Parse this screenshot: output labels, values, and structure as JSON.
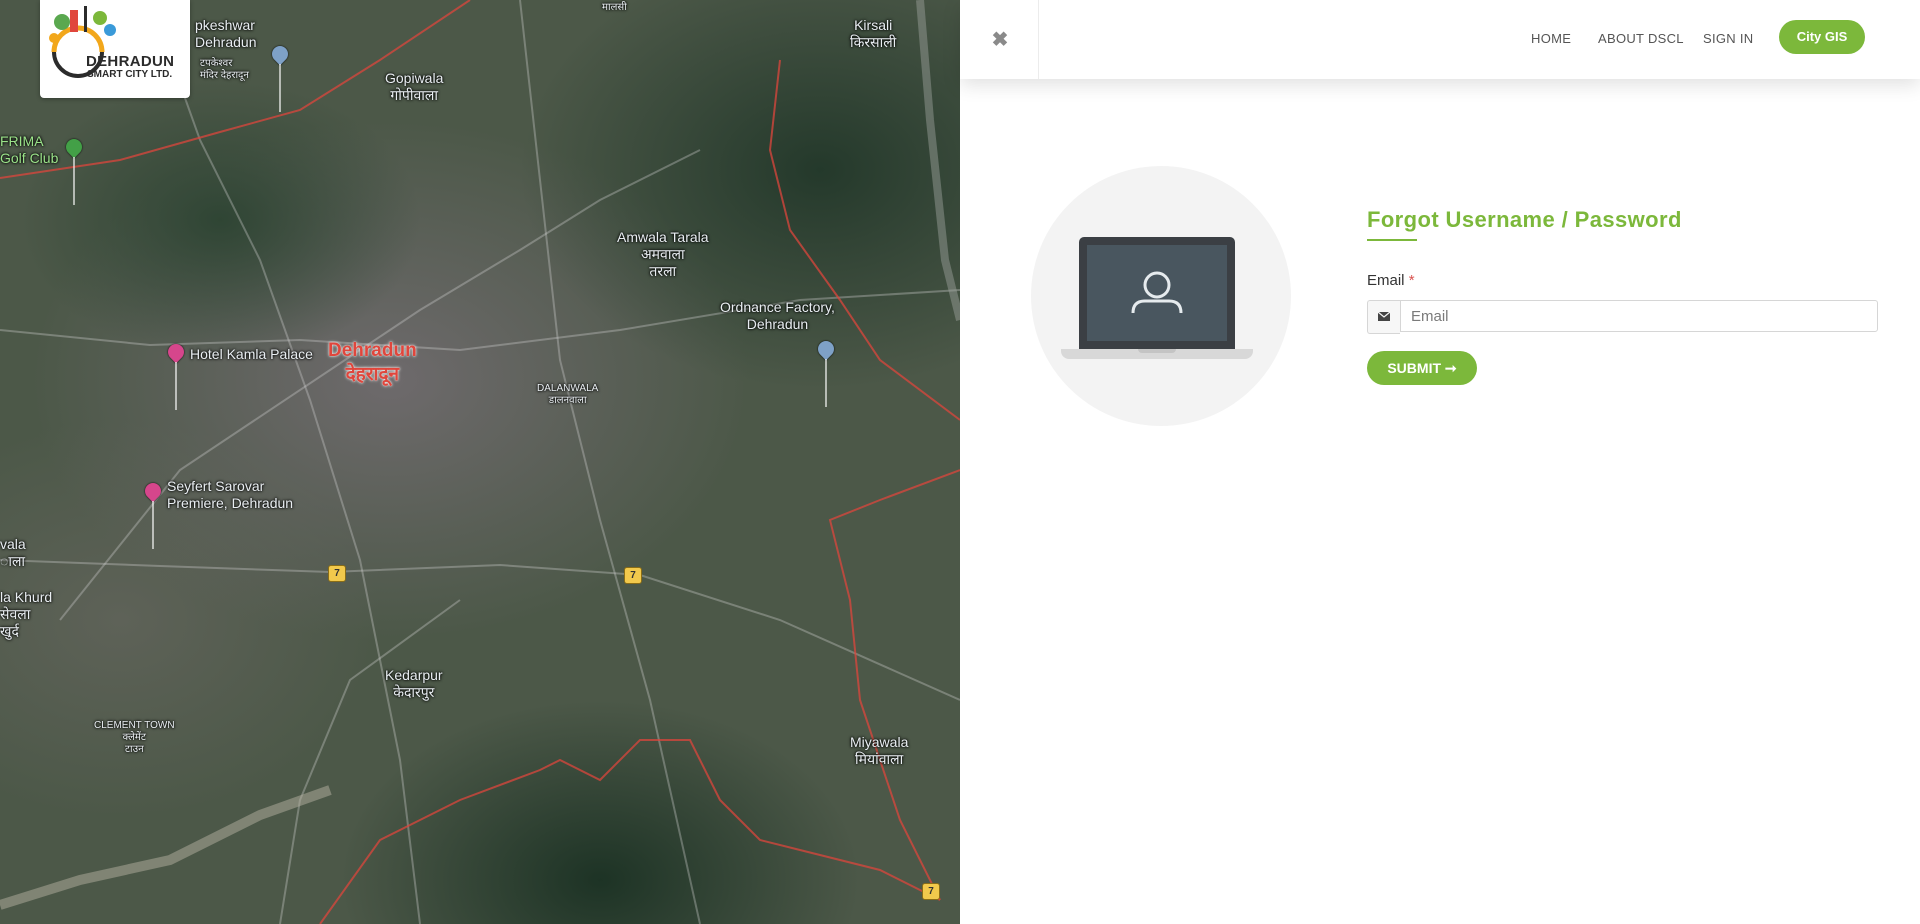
{
  "logo": {
    "line1": "DEHRADUN",
    "line2": "SMART CITY LTD."
  },
  "map": {
    "labels": [
      {
        "text": "pkeshwar\nDehradun",
        "kind": "place"
      },
      {
        "text": "टपकेश्वर\nमंदिर देहरादून",
        "kind": "place-small"
      },
      {
        "text": "Gopiwala\nगोपीवाला",
        "kind": "place"
      },
      {
        "text": "मालसी",
        "kind": "place-small"
      },
      {
        "text": "Kirsali\nकिरसाली",
        "kind": "place"
      },
      {
        "text": "FRIMA\nGolf Club",
        "kind": "poi"
      },
      {
        "text": "Amwala Tarala\nअमवाला\nतरला",
        "kind": "place"
      },
      {
        "text": "Ordnance Factory,\nDehradun",
        "kind": "poi"
      },
      {
        "text": "Hotel Kamla Palace",
        "kind": "poi"
      },
      {
        "text": "Dehradun\nदेहरादून",
        "kind": "city"
      },
      {
        "text": "DALANWALA\nडालनवाला",
        "kind": "place-small"
      },
      {
        "text": "Seyfert Sarovar\nPremiere, Dehradun",
        "kind": "poi"
      },
      {
        "text": "vala\nाला",
        "kind": "place"
      },
      {
        "text": "la Khurd\nसेवला\nखुर्द",
        "kind": "place"
      },
      {
        "text": "Kedarpur\nकेदारपुर",
        "kind": "place"
      },
      {
        "text": "CLEMENT TOWN\nक्लेमेंट\nटाउन",
        "kind": "place-small"
      },
      {
        "text": "Miyawala\nमियांवाला",
        "kind": "place"
      }
    ],
    "highway_number": "7"
  },
  "header": {
    "close_icon": "close-icon",
    "nav": [
      "HOME",
      "ABOUT DSCL",
      "SIGN IN"
    ],
    "cta": "City GIS"
  },
  "form": {
    "title": "Forgot Username / Password",
    "email_label": "Email",
    "required_mark": "*",
    "email_placeholder": "Email",
    "email_value": "",
    "email_icon": "envelope-icon",
    "submit_label": "SUBMIT ➞"
  },
  "colors": {
    "accent": "#7cb83b",
    "required": "#d9534f",
    "avatar_bg": "#f3f3f3"
  }
}
